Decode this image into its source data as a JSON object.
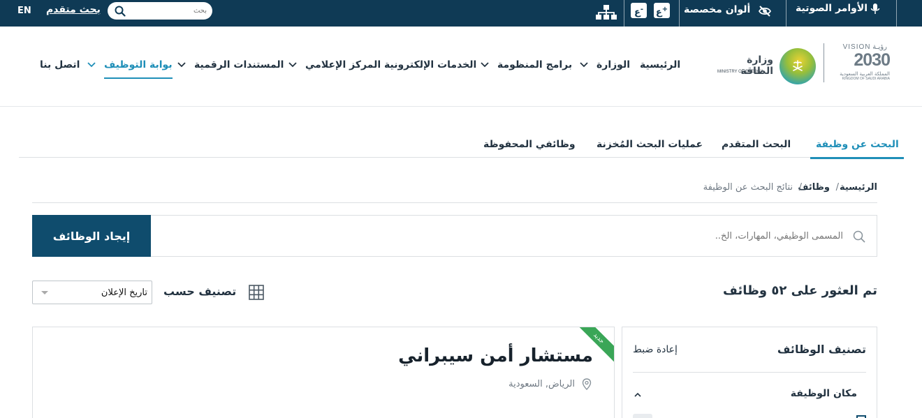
{
  "topbar": {
    "lang": "EN",
    "advanced_search": "بحث متقدم",
    "search_placeholder": "بحث",
    "font_increase": "ع",
    "font_increase_sign": "+",
    "font_decrease": "ع",
    "font_decrease_sign": "-",
    "custom_colors": "ألوان مخصصة",
    "voice_commands": "الأوامر الصوتية"
  },
  "logo": {
    "vision_ar": "رؤيـة",
    "vision_en": "VISION",
    "vision_year": "2030",
    "vision_kingdom_ar": "المملكة العربية السعودية",
    "vision_kingdom_en": "KINGDOM OF SAUDI ARABIA",
    "ministry_ar": "وزارة الطاقة",
    "ministry_en": "MINISTRY OF ENERGY"
  },
  "nav": {
    "home": "الرئيسية",
    "ministry": "الوزارة",
    "programs": "برامج المنظومة",
    "eservices": "الخدمات الإلكترونية",
    "media": "المركز الإعلامي",
    "documents": "المستندات الرقمية",
    "careers": "بوابة التوظيف",
    "contact": "اتصل بنا"
  },
  "tabs": {
    "job_search": "البحث عن وظيفة",
    "advanced": "البحث المتقدم",
    "saved_searches": "عمليات البحث المُخزنة",
    "saved_jobs": "وظائفي المحفوظة"
  },
  "breadcrumb": {
    "home": "الرئيسية",
    "sep1": "/",
    "jobs": "وظائف",
    "sep2": "/",
    "current": "نتائج البحث عن الوظيفة"
  },
  "search": {
    "placeholder": "المسمى الوظيفي، المهارات، الخ..",
    "button": "إيجاد الوظائف"
  },
  "results": {
    "count_text": "تم العثور على ٥٢ وظائف",
    "sort_label": "تصنيف حسب",
    "sort_value": "تاريخ الإعلان"
  },
  "filters": {
    "title": "تصنيف الوظائف",
    "reset": "إعادة ضبط",
    "location_title": "مكان الوظيفة"
  },
  "job": {
    "badge": "جديد",
    "title": "مستشار أمن سيبراني",
    "location": "الرياض, السعودية"
  },
  "colors": {
    "topbar": "#0f3a55",
    "primary_button": "#0f4c6d",
    "accent": "#1f8fb8",
    "new_badge": "#3aa657"
  }
}
